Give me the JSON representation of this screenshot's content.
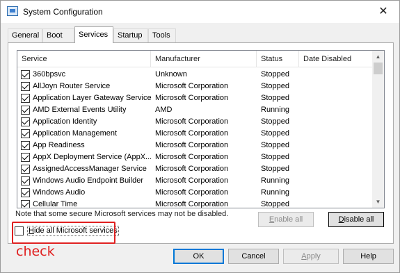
{
  "window": {
    "title": "System Configuration",
    "close_glyph": "✕",
    "icon": "msconfig-icon"
  },
  "tabs": [
    {
      "label": "General"
    },
    {
      "label": "Boot"
    },
    {
      "label": "Services",
      "active": true
    },
    {
      "label": "Startup"
    },
    {
      "label": "Tools"
    }
  ],
  "services_list": {
    "columns": [
      "Service",
      "Manufacturer",
      "Status",
      "Date Disabled"
    ],
    "rows": [
      {
        "service": "360bpsvc",
        "manufacturer": "Unknown",
        "status": "Stopped",
        "date_disabled": "",
        "checked": true
      },
      {
        "service": "AllJoyn Router Service",
        "manufacturer": "Microsoft Corporation",
        "status": "Stopped",
        "date_disabled": "",
        "checked": true
      },
      {
        "service": "Application Layer Gateway Service",
        "manufacturer": "Microsoft Corporation",
        "status": "Stopped",
        "date_disabled": "",
        "checked": true
      },
      {
        "service": "AMD External Events Utility",
        "manufacturer": "AMD",
        "status": "Running",
        "date_disabled": "",
        "checked": true
      },
      {
        "service": "Application Identity",
        "manufacturer": "Microsoft Corporation",
        "status": "Stopped",
        "date_disabled": "",
        "checked": true
      },
      {
        "service": "Application Management",
        "manufacturer": "Microsoft Corporation",
        "status": "Stopped",
        "date_disabled": "",
        "checked": true
      },
      {
        "service": "App Readiness",
        "manufacturer": "Microsoft Corporation",
        "status": "Stopped",
        "date_disabled": "",
        "checked": true
      },
      {
        "service": "AppX Deployment Service (AppX...",
        "manufacturer": "Microsoft Corporation",
        "status": "Stopped",
        "date_disabled": "",
        "checked": true
      },
      {
        "service": "AssignedAccessManager Service",
        "manufacturer": "Microsoft Corporation",
        "status": "Stopped",
        "date_disabled": "",
        "checked": true
      },
      {
        "service": "Windows Audio Endpoint Builder",
        "manufacturer": "Microsoft Corporation",
        "status": "Running",
        "date_disabled": "",
        "checked": true
      },
      {
        "service": "Windows Audio",
        "manufacturer": "Microsoft Corporation",
        "status": "Running",
        "date_disabled": "",
        "checked": true
      },
      {
        "service": "Cellular Time",
        "manufacturer": "Microsoft Corporation",
        "status": "Stopped",
        "date_disabled": "",
        "checked": true
      }
    ]
  },
  "note": "Note that some secure Microsoft services may not be disabled.",
  "buttons": {
    "enable_all_prefix": "E",
    "enable_all_rest": "nable all",
    "disable_all_prefix": "D",
    "disable_all_rest": "isable all"
  },
  "hide_microsoft": {
    "prefix": "H",
    "rest": "ide all Microsoft services",
    "checked": false
  },
  "annotation": {
    "text": "check",
    "color": "#e02020"
  },
  "footer": {
    "ok": "OK",
    "cancel": "Cancel",
    "apply_prefix": "A",
    "apply_rest": "pply",
    "help": "Help"
  }
}
